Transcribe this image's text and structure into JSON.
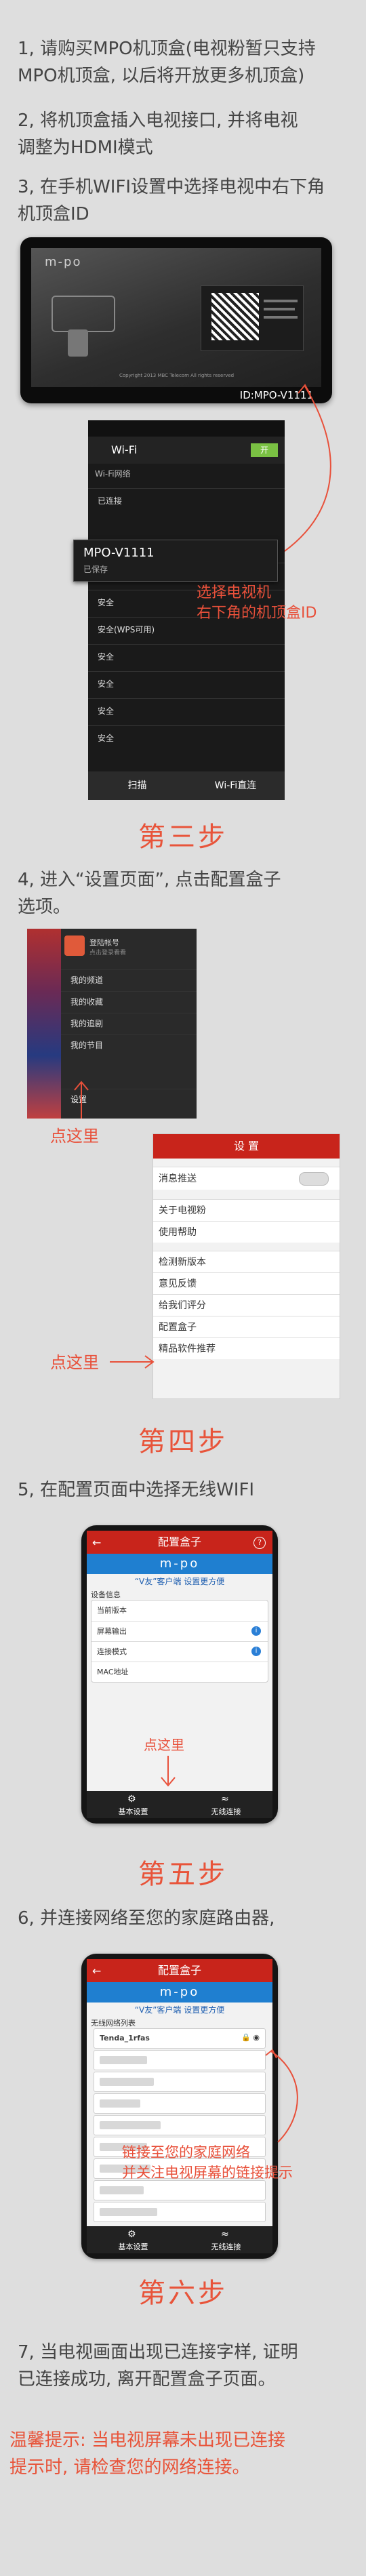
{
  "steps": {
    "s1": [
      "1, 请购买MPO机顶盒(电视粉暂只支持",
      "MPO机顶盒, 以后将开放更多机顶盒)"
    ],
    "s2": [
      "2, 将机顶盒插入电视接口, 并将电视",
      "调整为HDMI模式"
    ],
    "s3": [
      "3, 在手机WIFI设置中选择电视中右下角",
      "机顶盒ID"
    ],
    "s4": [
      "4, 进入“设置页面”, 点击配置盒子",
      "选项。"
    ],
    "s5": "5, 在配置页面中选择无线WIFI",
    "s6": "6, 并连接网络至您的家庭路由器,",
    "s7": [
      "7, 当电视画面出现已连接字样, 证明",
      "已连接成功, 离开配置盒子页面。"
    ],
    "tip": [
      "温馨提示: 当电视屏幕未出现已连接",
      "提示时, 请检查您的网络连接。"
    ]
  },
  "titles": {
    "t3": "第三步",
    "t4": "第四步",
    "t5": "第五步",
    "t6": "第六步"
  },
  "tv": {
    "brand": "m-po",
    "small_text": "Copyright 2013 MBC Telecom All rights reserved",
    "id_label": "ID:MPO-V1111"
  },
  "wifi_screen": {
    "status": "Wi-Fi",
    "toggle": "开",
    "section": "Wi-Fi网络",
    "popup_title": "MPO-V1111",
    "popup_sub": "已保存",
    "rows": [
      "已连接",
      "安全",
      "安全",
      "安全(WPS可用)",
      "安全",
      "安全",
      "安全",
      "安全"
    ],
    "scan": "扫描",
    "direct": "Wi-Fi直连",
    "annotation": [
      "选择电视机",
      "右下角的机顶盒ID"
    ]
  },
  "step4": {
    "account": "登陆帐号",
    "account_sub": "点击登录看看",
    "menu": [
      "我的频道",
      "我的收藏",
      "我的追剧",
      "我的节目"
    ],
    "settings": "设置",
    "click_here": "点这里",
    "settings_title": "设 置",
    "items": [
      "消息推送",
      "关于电视粉",
      "使用帮助",
      "检测新版本",
      "意见反馈",
      "给我们评分",
      "配置盒子",
      "精品软件推荐"
    ]
  },
  "step5": {
    "title": "配置盒子",
    "brand": "m-po",
    "banner": "“V友”客户端 设置更方便",
    "section": "设备信息",
    "rows": [
      "当前版本",
      "屏幕输出",
      "连接模式",
      "MAC地址"
    ],
    "click_here": "点这里",
    "tab1": "基本设置",
    "tab2": "无线连接"
  },
  "step6": {
    "title": "配置盒子",
    "brand": "m-po",
    "banner": "“V友”客户端 设置更方便",
    "section": "无线网络列表",
    "first": "Tenda_1rfas",
    "annotation": [
      "链接至您的家庭网络",
      "并关注电视屏幕的链接提示"
    ],
    "tab1": "基本设置",
    "tab2": "无线连接"
  },
  "colors": {
    "accent": "#e8543a",
    "bar": "#c8241b",
    "blue": "#2a7fd6"
  }
}
